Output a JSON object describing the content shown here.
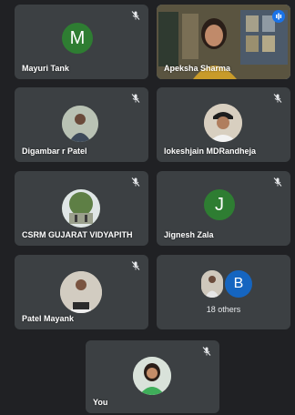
{
  "participants": [
    {
      "name": "Mayuri Tank",
      "avatar_letter": "M",
      "avatar_color": "#2e7d32"
    },
    {
      "name": "Apeksha Sharma"
    },
    {
      "name": "Digambar r Patel"
    },
    {
      "name": "lokeshjain MDRandheja"
    },
    {
      "name": "CSRM GUJARAT VIDYAPITH"
    },
    {
      "name": "Jignesh Zala",
      "avatar_letter": "J",
      "avatar_color": "#2e7d32"
    },
    {
      "name": "Patel Mayank"
    },
    {
      "name": "You"
    }
  ],
  "others": {
    "label": "18 others",
    "avatar_letter": "B",
    "avatar_color": "#1565c0"
  },
  "colors": {
    "background": "#202124",
    "tile": "#3c4043",
    "active_border": "#8ab4f8",
    "speaking_indicator": "#1a73e8"
  },
  "icons": {
    "mute": "mic-off-icon",
    "speaking": "audio-level-icon"
  }
}
